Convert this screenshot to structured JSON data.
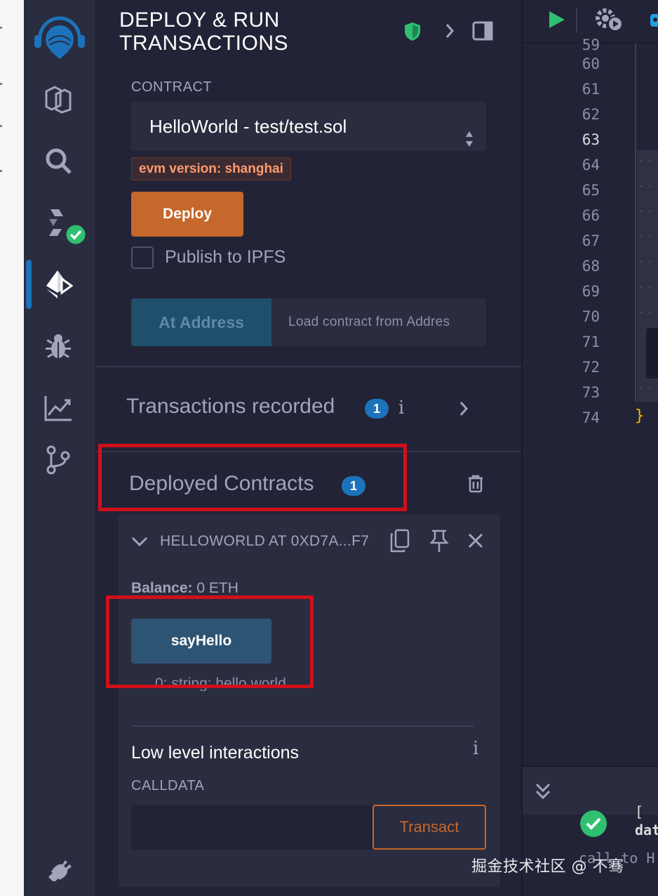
{
  "panel": {
    "title_line1": "DEPLOY & RUN",
    "title_line2": "TRANSACTIONS"
  },
  "contract": {
    "label": "CONTRACT",
    "selected": "HelloWorld - test/test.sol",
    "evm_badge": "evm version: shanghai"
  },
  "deploy": {
    "deploy_label": "Deploy",
    "publish_ipfs_label": "Publish to IPFS",
    "publish_ipfs_checked": false,
    "at_address_label": "At Address",
    "load_contract_placeholder": "Load contract from Addres"
  },
  "transactions": {
    "title": "Transactions recorded",
    "count": "1"
  },
  "deployed": {
    "title": "Deployed Contracts",
    "count": "1",
    "instance": {
      "title": "HELLOWORLD AT 0XD7A...F7",
      "balance_label": "Balance:",
      "balance_value": "0 ETH",
      "method_label": "sayHello",
      "result_text": "0: string: hello world"
    },
    "low_level": {
      "title": "Low level interactions",
      "calldata_label": "CALLDATA",
      "transact_label": "Transact"
    }
  },
  "editor": {
    "line_numbers": [
      "60",
      "61",
      "62",
      "63",
      "64",
      "65",
      "66",
      "67",
      "68",
      "69",
      "70",
      "71",
      "72",
      "73",
      "74"
    ],
    "current_line": "63",
    "closing_brace": "}",
    "terminal_line1": "[",
    "terminal_line2": "dat",
    "terminal_line3": "call to H"
  },
  "watermark": "掘金技术社区 @ 不骞",
  "colors": {
    "accent_orange": "#c6672b",
    "accent_blue": "#1c73bb",
    "highlight_red": "#d0101b",
    "success_green": "#2fbf71"
  },
  "icons": [
    "remix-logo-icon",
    "file-explorer-icon",
    "search-icon",
    "solidity-compiler-icon",
    "deploy-run-icon",
    "debugger-icon",
    "analytics-icon",
    "git-icon",
    "plugin-icon",
    "shield-icon",
    "chevron-right-icon",
    "panel-toggle-icon",
    "dropdown-arrows-icon",
    "trash-icon",
    "chevron-down-icon",
    "copy-icon",
    "pin-icon",
    "close-icon",
    "info-icon",
    "run-icon",
    "settings-run-icon",
    "double-chevron-down-icon",
    "check-circle-icon"
  ]
}
